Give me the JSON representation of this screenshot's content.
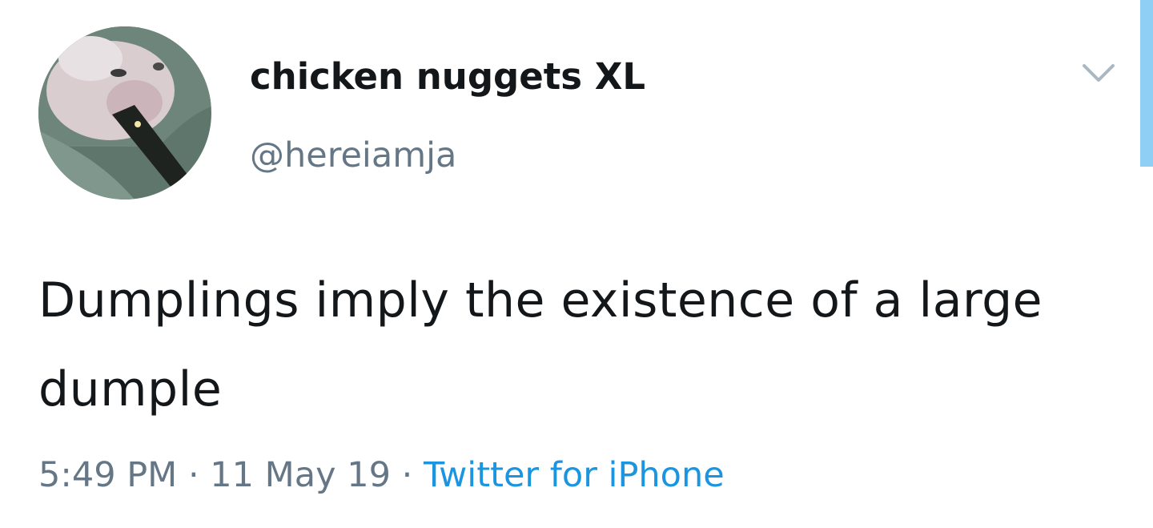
{
  "tweet": {
    "display_name": "chicken nuggets XL",
    "handle": "@hereiamja",
    "text": "Dumplings imply the existence of a large dumple",
    "time": "5:49 PM",
    "separator": "·",
    "date": "11 May 19",
    "source": "Twitter for iPhone"
  },
  "icons": {
    "caret": "chevron-down-icon",
    "avatar": "cat-avatar"
  },
  "colors": {
    "text": "#14171a",
    "muted": "#657786",
    "link": "#1b95e0",
    "scroll_indicator": "#8fcff6",
    "background": "#ffffff"
  }
}
